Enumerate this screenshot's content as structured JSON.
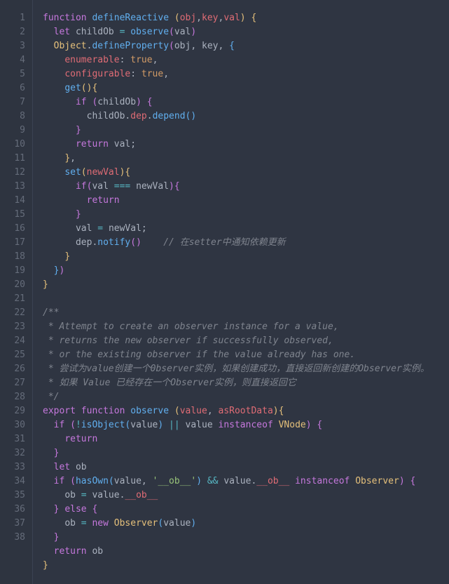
{
  "gutter": {
    "start": 1,
    "end": 38
  },
  "lines": [
    [
      {
        "c": "kw",
        "t": "function"
      },
      {
        "c": "pn",
        "t": " "
      },
      {
        "c": "fn",
        "t": "defineReactive"
      },
      {
        "c": "pn",
        "t": " "
      },
      {
        "c": "par-y",
        "t": "("
      },
      {
        "c": "prop",
        "t": "obj"
      },
      {
        "c": "pn",
        "t": ","
      },
      {
        "c": "prop",
        "t": "key"
      },
      {
        "c": "pn",
        "t": ","
      },
      {
        "c": "prop",
        "t": "val"
      },
      {
        "c": "par-y",
        "t": ")"
      },
      {
        "c": "pn",
        "t": " "
      },
      {
        "c": "par-y",
        "t": "{"
      }
    ],
    [
      {
        "c": "pn",
        "t": "  "
      },
      {
        "c": "kw",
        "t": "let"
      },
      {
        "c": "pn",
        "t": " "
      },
      {
        "c": "id",
        "t": "childOb"
      },
      {
        "c": "pn",
        "t": " "
      },
      {
        "c": "op",
        "t": "="
      },
      {
        "c": "pn",
        "t": " "
      },
      {
        "c": "fn",
        "t": "observe"
      },
      {
        "c": "par-p",
        "t": "("
      },
      {
        "c": "id",
        "t": "val"
      },
      {
        "c": "par-p",
        "t": ")"
      }
    ],
    [
      {
        "c": "pn",
        "t": "  "
      },
      {
        "c": "cls",
        "t": "Object"
      },
      {
        "c": "pn",
        "t": "."
      },
      {
        "c": "fn",
        "t": "defineProperty"
      },
      {
        "c": "par-p",
        "t": "("
      },
      {
        "c": "id",
        "t": "obj"
      },
      {
        "c": "pn",
        "t": ", "
      },
      {
        "c": "id",
        "t": "key"
      },
      {
        "c": "pn",
        "t": ", "
      },
      {
        "c": "par-b",
        "t": "{"
      }
    ],
    [
      {
        "c": "pn",
        "t": "    "
      },
      {
        "c": "prop",
        "t": "enumerable"
      },
      {
        "c": "pn",
        "t": ": "
      },
      {
        "c": "num",
        "t": "true"
      },
      {
        "c": "pn",
        "t": ","
      }
    ],
    [
      {
        "c": "pn",
        "t": "    "
      },
      {
        "c": "prop",
        "t": "configurable"
      },
      {
        "c": "pn",
        "t": ": "
      },
      {
        "c": "num",
        "t": "true"
      },
      {
        "c": "pn",
        "t": ","
      }
    ],
    [
      {
        "c": "pn",
        "t": "    "
      },
      {
        "c": "fn",
        "t": "get"
      },
      {
        "c": "par-y",
        "t": "()"
      },
      {
        "c": "par-y",
        "t": "{"
      }
    ],
    [
      {
        "c": "pn",
        "t": "      "
      },
      {
        "c": "kw",
        "t": "if"
      },
      {
        "c": "pn",
        "t": " "
      },
      {
        "c": "par-p",
        "t": "("
      },
      {
        "c": "id",
        "t": "childOb"
      },
      {
        "c": "par-p",
        "t": ")"
      },
      {
        "c": "pn",
        "t": " "
      },
      {
        "c": "par-p",
        "t": "{"
      }
    ],
    [
      {
        "c": "pn",
        "t": "        "
      },
      {
        "c": "id",
        "t": "childOb"
      },
      {
        "c": "pn",
        "t": "."
      },
      {
        "c": "prop",
        "t": "dep"
      },
      {
        "c": "pn",
        "t": "."
      },
      {
        "c": "fn",
        "t": "depend"
      },
      {
        "c": "par-b",
        "t": "()"
      }
    ],
    [
      {
        "c": "pn",
        "t": "      "
      },
      {
        "c": "par-p",
        "t": "}"
      }
    ],
    [
      {
        "c": "pn",
        "t": "      "
      },
      {
        "c": "kw",
        "t": "return"
      },
      {
        "c": "pn",
        "t": " "
      },
      {
        "c": "id",
        "t": "val"
      },
      {
        "c": "pn",
        "t": ";"
      }
    ],
    [
      {
        "c": "pn",
        "t": "    "
      },
      {
        "c": "par-y",
        "t": "}"
      },
      {
        "c": "pn",
        "t": ","
      }
    ],
    [
      {
        "c": "pn",
        "t": "    "
      },
      {
        "c": "fn",
        "t": "set"
      },
      {
        "c": "par-y",
        "t": "("
      },
      {
        "c": "prop",
        "t": "newVal"
      },
      {
        "c": "par-y",
        "t": ")"
      },
      {
        "c": "par-y",
        "t": "{"
      }
    ],
    [
      {
        "c": "pn",
        "t": "      "
      },
      {
        "c": "kw",
        "t": "if"
      },
      {
        "c": "par-p",
        "t": "("
      },
      {
        "c": "id",
        "t": "val"
      },
      {
        "c": "pn",
        "t": " "
      },
      {
        "c": "op",
        "t": "==="
      },
      {
        "c": "pn",
        "t": " "
      },
      {
        "c": "id",
        "t": "newVal"
      },
      {
        "c": "par-p",
        "t": ")"
      },
      {
        "c": "par-p",
        "t": "{"
      }
    ],
    [
      {
        "c": "pn",
        "t": "        "
      },
      {
        "c": "kw",
        "t": "return"
      }
    ],
    [
      {
        "c": "pn",
        "t": "      "
      },
      {
        "c": "par-p",
        "t": "}"
      }
    ],
    [
      {
        "c": "pn",
        "t": "      "
      },
      {
        "c": "id",
        "t": "val"
      },
      {
        "c": "pn",
        "t": " "
      },
      {
        "c": "op",
        "t": "="
      },
      {
        "c": "pn",
        "t": " "
      },
      {
        "c": "id",
        "t": "newVal"
      },
      {
        "c": "pn",
        "t": ";"
      }
    ],
    [
      {
        "c": "pn",
        "t": "      "
      },
      {
        "c": "id",
        "t": "dep"
      },
      {
        "c": "pn",
        "t": "."
      },
      {
        "c": "fn",
        "t": "notify"
      },
      {
        "c": "par-p",
        "t": "()"
      },
      {
        "c": "pn",
        "t": "    "
      },
      {
        "c": "cm",
        "t": "// 在setter中通知依赖更新"
      }
    ],
    [
      {
        "c": "pn",
        "t": "    "
      },
      {
        "c": "par-y",
        "t": "}"
      }
    ],
    [
      {
        "c": "pn",
        "t": "  "
      },
      {
        "c": "par-b",
        "t": "}"
      },
      {
        "c": "par-p",
        "t": ")"
      }
    ],
    [
      {
        "c": "par-y",
        "t": "}"
      }
    ],
    [
      {
        "c": "pn",
        "t": ""
      }
    ],
    [
      {
        "c": "cm",
        "t": "/**"
      }
    ],
    [
      {
        "c": "cm",
        "t": " * Attempt to create an observer instance for a value,"
      }
    ],
    [
      {
        "c": "cm",
        "t": " * returns the new observer if successfully observed,"
      }
    ],
    [
      {
        "c": "cm",
        "t": " * or the existing observer if the value already has one."
      }
    ],
    [
      {
        "c": "cm",
        "t": " * 尝试为value创建一个0bserver实例，如果创建成功，直接返回新创建的Observer实例。"
      }
    ],
    [
      {
        "c": "cm",
        "t": " * 如果 Value 已经存在一个Observer实例，则直接返回它"
      }
    ],
    [
      {
        "c": "cm",
        "t": " */"
      }
    ],
    [
      {
        "c": "kw",
        "t": "export"
      },
      {
        "c": "pn",
        "t": " "
      },
      {
        "c": "kw",
        "t": "function"
      },
      {
        "c": "pn",
        "t": " "
      },
      {
        "c": "fn",
        "t": "observe"
      },
      {
        "c": "pn",
        "t": " "
      },
      {
        "c": "par-y",
        "t": "("
      },
      {
        "c": "prop",
        "t": "value"
      },
      {
        "c": "pn",
        "t": ", "
      },
      {
        "c": "prop",
        "t": "asRootData"
      },
      {
        "c": "par-y",
        "t": ")"
      },
      {
        "c": "par-y",
        "t": "{"
      }
    ],
    [
      {
        "c": "pn",
        "t": "  "
      },
      {
        "c": "kw",
        "t": "if"
      },
      {
        "c": "pn",
        "t": " "
      },
      {
        "c": "par-p",
        "t": "("
      },
      {
        "c": "op",
        "t": "!"
      },
      {
        "c": "fn",
        "t": "isObject"
      },
      {
        "c": "par-b",
        "t": "("
      },
      {
        "c": "id",
        "t": "value"
      },
      {
        "c": "par-b",
        "t": ")"
      },
      {
        "c": "pn",
        "t": " "
      },
      {
        "c": "op",
        "t": "||"
      },
      {
        "c": "pn",
        "t": " "
      },
      {
        "c": "id",
        "t": "value"
      },
      {
        "c": "pn",
        "t": " "
      },
      {
        "c": "kw",
        "t": "instanceof"
      },
      {
        "c": "pn",
        "t": " "
      },
      {
        "c": "cls",
        "t": "VNode"
      },
      {
        "c": "par-p",
        "t": ")"
      },
      {
        "c": "pn",
        "t": " "
      },
      {
        "c": "par-p",
        "t": "{"
      }
    ],
    [
      {
        "c": "pn",
        "t": "    "
      },
      {
        "c": "kw",
        "t": "return"
      }
    ],
    [
      {
        "c": "pn",
        "t": "  "
      },
      {
        "c": "par-p",
        "t": "}"
      }
    ],
    [
      {
        "c": "pn",
        "t": "  "
      },
      {
        "c": "kw",
        "t": "let"
      },
      {
        "c": "pn",
        "t": " "
      },
      {
        "c": "id",
        "t": "ob"
      }
    ],
    [
      {
        "c": "pn",
        "t": "  "
      },
      {
        "c": "kw",
        "t": "if"
      },
      {
        "c": "pn",
        "t": " "
      },
      {
        "c": "par-p",
        "t": "("
      },
      {
        "c": "fn",
        "t": "hasOwn"
      },
      {
        "c": "par-b",
        "t": "("
      },
      {
        "c": "id",
        "t": "value"
      },
      {
        "c": "pn",
        "t": ", "
      },
      {
        "c": "str",
        "t": "'__ob__'"
      },
      {
        "c": "par-b",
        "t": ")"
      },
      {
        "c": "pn",
        "t": " "
      },
      {
        "c": "op",
        "t": "&&"
      },
      {
        "c": "pn",
        "t": " "
      },
      {
        "c": "id",
        "t": "value"
      },
      {
        "c": "pn",
        "t": "."
      },
      {
        "c": "prop",
        "t": "__ob__"
      },
      {
        "c": "pn",
        "t": " "
      },
      {
        "c": "kw",
        "t": "instanceof"
      },
      {
        "c": "pn",
        "t": " "
      },
      {
        "c": "cls",
        "t": "Observer"
      },
      {
        "c": "par-p",
        "t": ")"
      },
      {
        "c": "pn",
        "t": " "
      },
      {
        "c": "par-p",
        "t": "{"
      }
    ],
    [
      {
        "c": "pn",
        "t": "    "
      },
      {
        "c": "id",
        "t": "ob"
      },
      {
        "c": "pn",
        "t": " "
      },
      {
        "c": "op",
        "t": "="
      },
      {
        "c": "pn",
        "t": " "
      },
      {
        "c": "id",
        "t": "value"
      },
      {
        "c": "pn",
        "t": "."
      },
      {
        "c": "prop",
        "t": "__ob__"
      }
    ],
    [
      {
        "c": "pn",
        "t": "  "
      },
      {
        "c": "par-p",
        "t": "}"
      },
      {
        "c": "pn",
        "t": " "
      },
      {
        "c": "kw",
        "t": "else"
      },
      {
        "c": "pn",
        "t": " "
      },
      {
        "c": "par-p",
        "t": "{"
      }
    ],
    [
      {
        "c": "pn",
        "t": "    "
      },
      {
        "c": "id",
        "t": "ob"
      },
      {
        "c": "pn",
        "t": " "
      },
      {
        "c": "op",
        "t": "="
      },
      {
        "c": "pn",
        "t": " "
      },
      {
        "c": "kw",
        "t": "new"
      },
      {
        "c": "pn",
        "t": " "
      },
      {
        "c": "cls",
        "t": "Observer"
      },
      {
        "c": "par-b",
        "t": "("
      },
      {
        "c": "id",
        "t": "value"
      },
      {
        "c": "par-b",
        "t": ")"
      }
    ],
    [
      {
        "c": "pn",
        "t": "  "
      },
      {
        "c": "par-p",
        "t": "}"
      }
    ],
    [
      {
        "c": "pn",
        "t": "  "
      },
      {
        "c": "kw",
        "t": "return"
      },
      {
        "c": "pn",
        "t": " "
      },
      {
        "c": "id",
        "t": "ob"
      }
    ],
    [
      {
        "c": "par-y",
        "t": "}"
      }
    ]
  ]
}
